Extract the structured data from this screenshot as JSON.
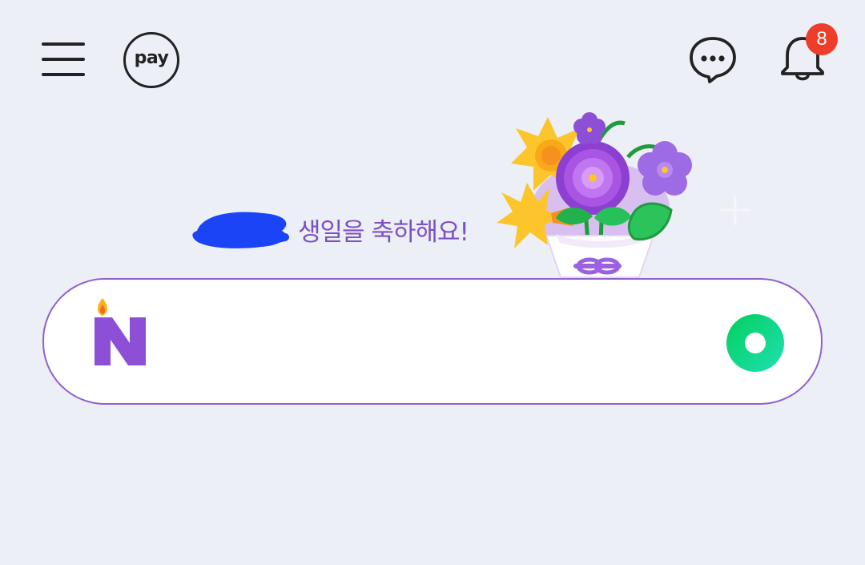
{
  "header": {
    "pay_label": "pay",
    "notification_count": "8",
    "icons": [
      "hamburger-menu-icon",
      "pay-icon",
      "chat-bubble-icon",
      "bell-icon"
    ]
  },
  "greeting": {
    "message": "생일을 축하해요!"
  },
  "search": {
    "placeholder": "",
    "value": ""
  },
  "colors": {
    "background": "#eceff5",
    "accent_purple": "#8f60cf",
    "greeting_text": "#7d4fc7",
    "badge": "#ee3e2b",
    "naver_green": "#03c75a"
  }
}
